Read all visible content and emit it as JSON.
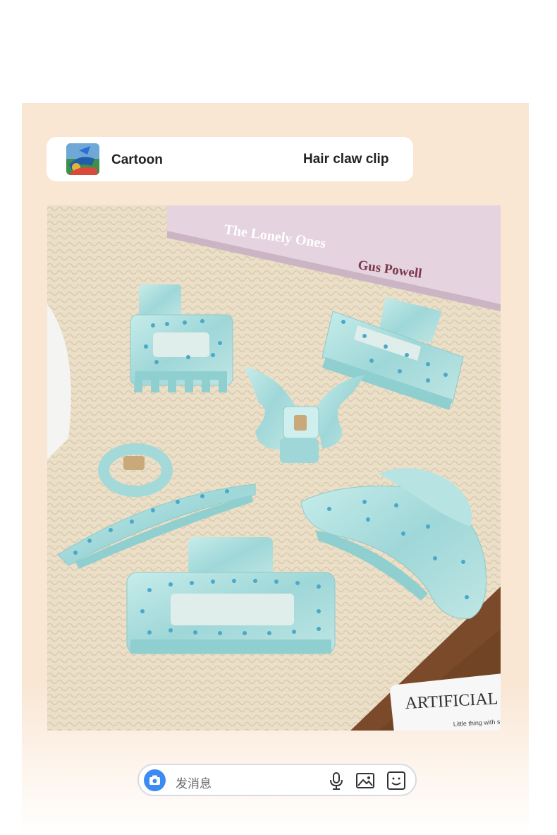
{
  "chat_header": {
    "name": "Cartoon",
    "title": "Hair claw clip"
  },
  "photo": {
    "book_title": "The Lonely Ones",
    "book_author": "Gus Powell",
    "card_text": "ARTIFICIAL",
    "card_subtext": "Little thing with sp",
    "colors": {
      "clip": "#a9dcdc",
      "knit": "#e9dcc4",
      "book": "#e5d3df",
      "wood": "#7a4a2a"
    }
  },
  "input_bar": {
    "placeholder": "发消息",
    "icons": [
      "camera-icon",
      "microphone-icon",
      "image-icon",
      "emoji-icon"
    ]
  }
}
